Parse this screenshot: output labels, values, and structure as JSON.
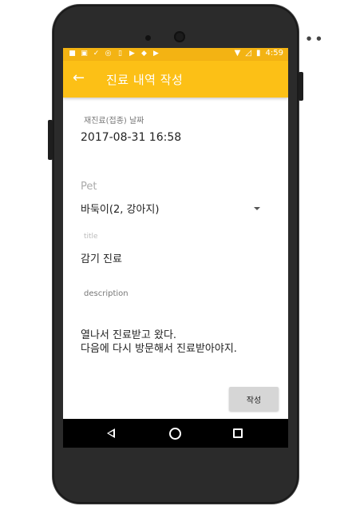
{
  "status_bar": {
    "time": "4:59"
  },
  "app_bar": {
    "title": "진료 내역 작성"
  },
  "form": {
    "date_label": "재진료(접종) 날짜",
    "date_value": "2017-08-31 16:58",
    "pet_label": "Pet",
    "pet_value": "바둑이(2, 강아지)",
    "title_label": "title",
    "title_value": "감기 진료",
    "description_label": "description",
    "description_line1": "열나서 진료받고 왔다.",
    "description_line2": "다음에 다시 방문해서 진료받아야지.",
    "submit_label": "작성"
  },
  "icons": {
    "status_left": [
      "notification-icon",
      "image-icon",
      "check-icon",
      "location-icon",
      "phone-icon",
      "play-icon",
      "android-icon",
      "play-icon"
    ],
    "status_right": [
      "wifi-icon",
      "signal-off-icon",
      "battery-charging-icon"
    ],
    "app_bar_back": "back-arrow-icon",
    "pet_dropdown": "dropdown-caret-icon",
    "nav": [
      "nav-back-icon",
      "nav-home-icon",
      "nav-recents-icon"
    ]
  },
  "colors": {
    "app_bar": "#fcc016",
    "status_bar": "#f3b313",
    "button": "#d6d6d6"
  }
}
